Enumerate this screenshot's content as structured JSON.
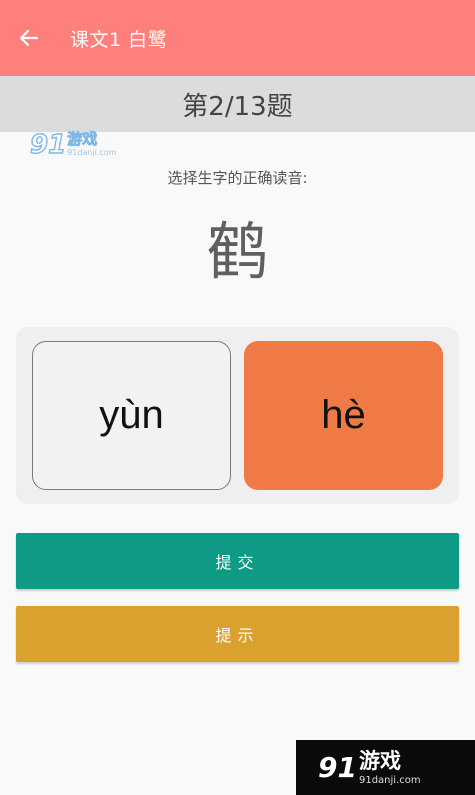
{
  "app_bar": {
    "title": "课文1 白鹭",
    "back_icon": "arrow-left-icon"
  },
  "question_bar": {
    "progress": "第2/13题"
  },
  "question": {
    "instruction": "选择生字的正确读音:",
    "character": "鹤"
  },
  "choices": [
    {
      "label": "yùn",
      "selected": false
    },
    {
      "label": "hè",
      "selected": true
    }
  ],
  "buttons": {
    "submit_label": "提交",
    "hint_label": "提示"
  },
  "watermark": {
    "brand_num": "91",
    "brand_cn": "游戏",
    "url": "91danji.com"
  },
  "colors": {
    "app_bar": "#ff7f7b",
    "question_bar": "#dcdcdc",
    "selected_choice": "#ef7a45",
    "submit": "#0e9a85",
    "hint": "#dba12e"
  }
}
